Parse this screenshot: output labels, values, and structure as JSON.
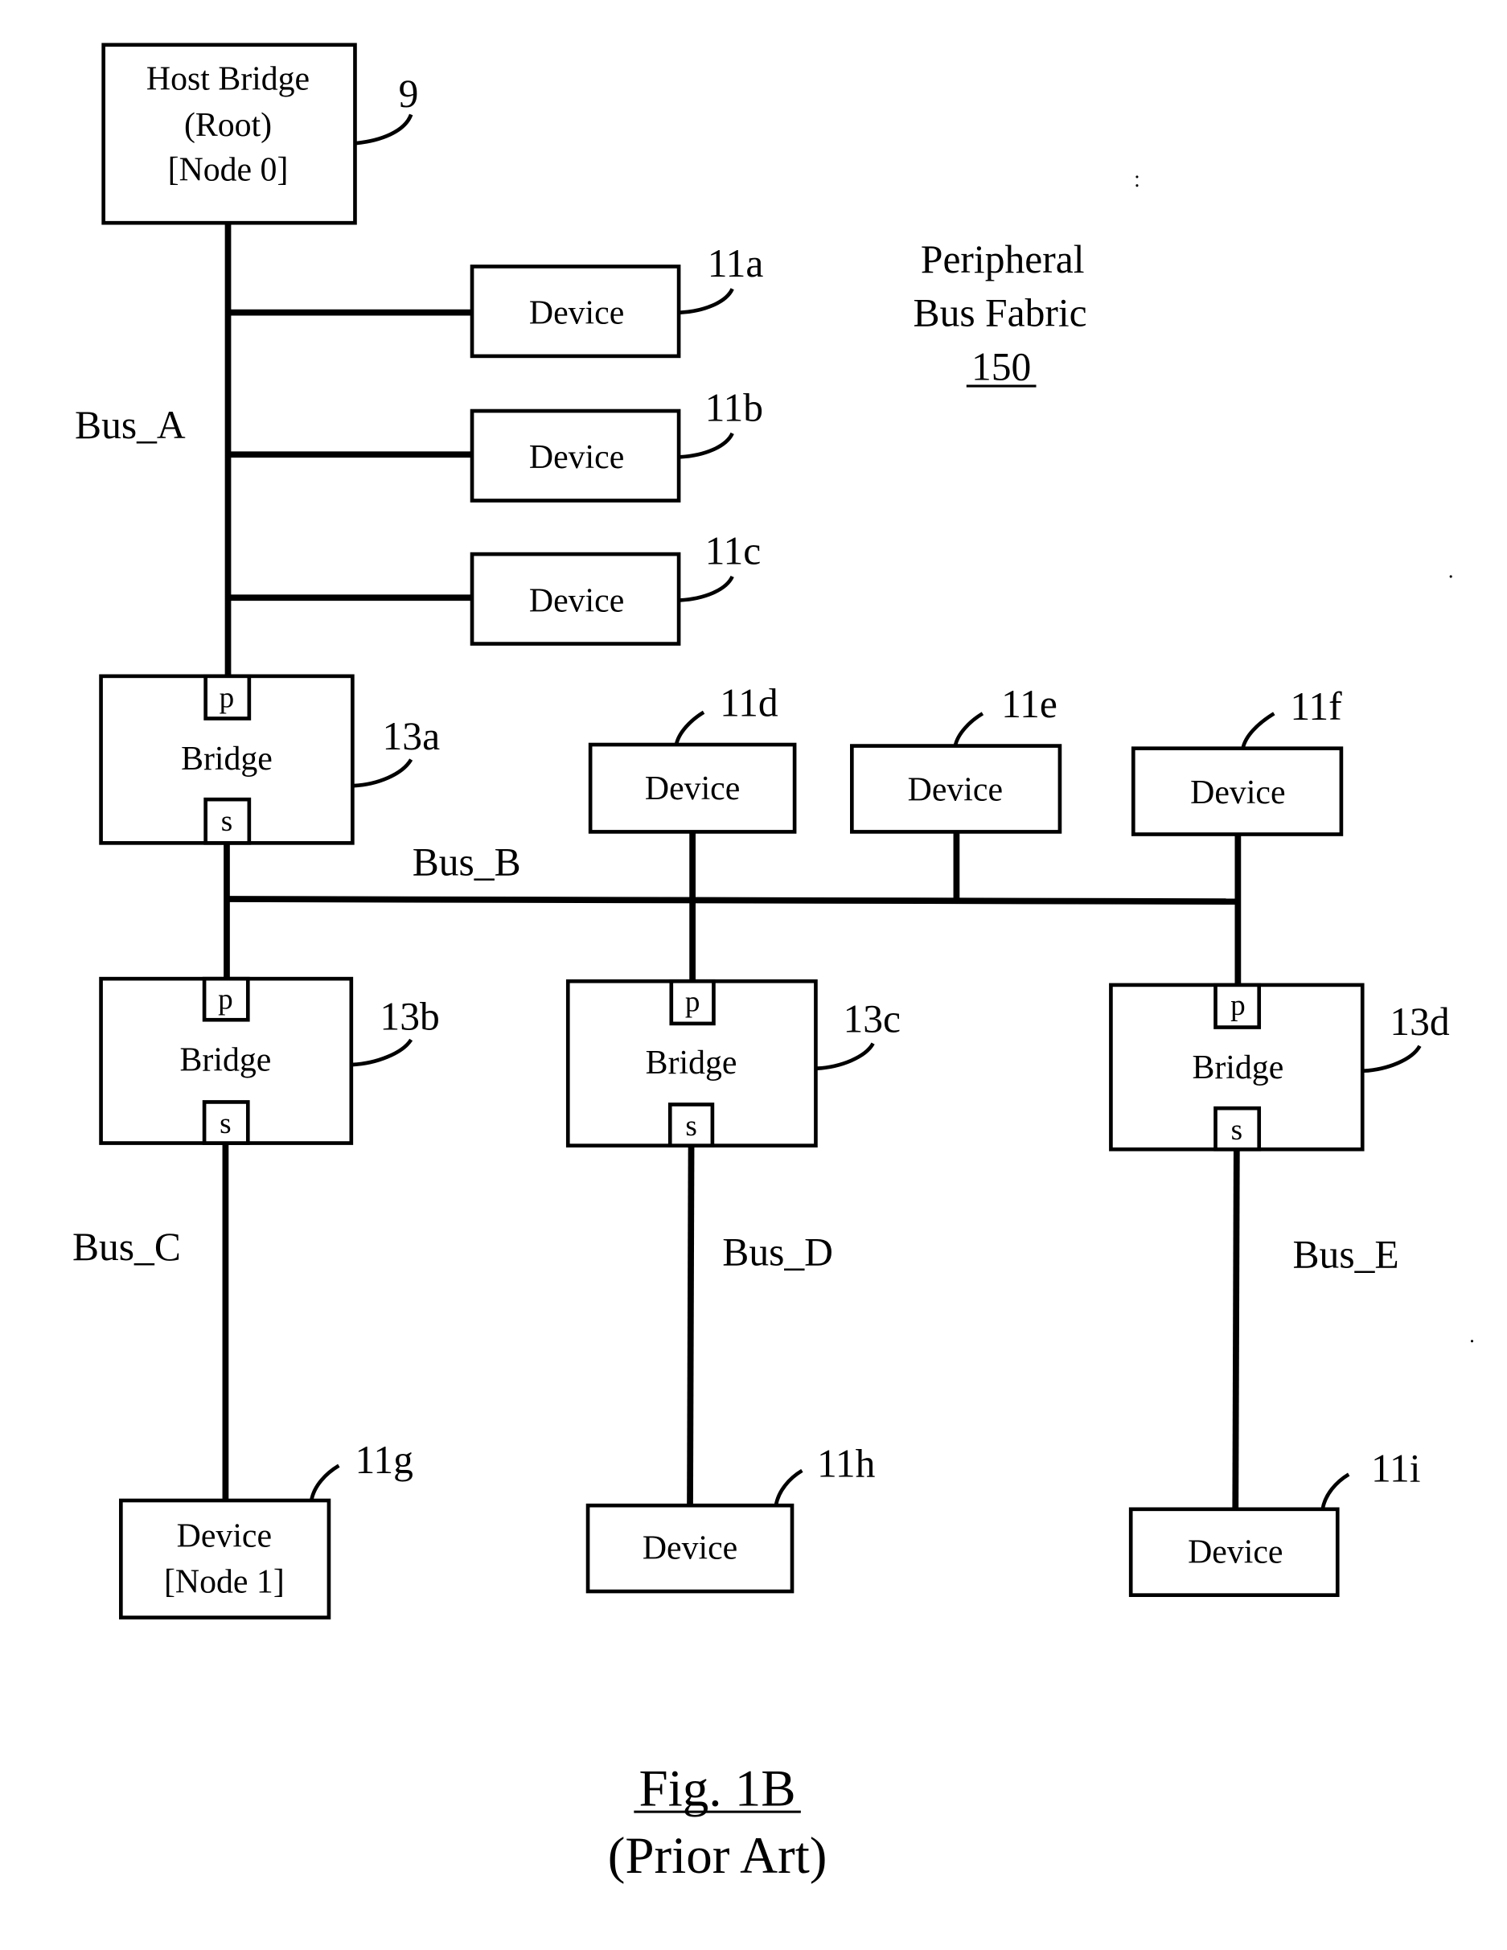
{
  "figure": {
    "caption": "Fig. 1B",
    "subcaption": "(Prior Art)"
  },
  "fabric": {
    "line1": "Peripheral",
    "line2": "Bus Fabric",
    "ref": "150"
  },
  "host_bridge": {
    "line1": "Host Bridge",
    "line2": "(Root)",
    "line3": "[Node 0]",
    "ref": "9"
  },
  "buses": {
    "a": "Bus_A",
    "b": "Bus_B",
    "c": "Bus_C",
    "d": "Bus_D",
    "e": "Bus_E"
  },
  "bridges": [
    {
      "label": "Bridge",
      "ref": "13a",
      "primary_port": "p",
      "secondary_port": "s"
    },
    {
      "label": "Bridge",
      "ref": "13b",
      "primary_port": "p",
      "secondary_port": "s"
    },
    {
      "label": "Bridge",
      "ref": "13c",
      "primary_port": "p",
      "secondary_port": "s"
    },
    {
      "label": "Bridge",
      "ref": "13d",
      "primary_port": "p",
      "secondary_port": "s"
    }
  ],
  "devices": [
    {
      "label": "Device",
      "ref": "11a"
    },
    {
      "label": "Device",
      "ref": "11b"
    },
    {
      "label": "Device",
      "ref": "11c"
    },
    {
      "label": "Device",
      "ref": "11d"
    },
    {
      "label": "Device",
      "ref": "11e"
    },
    {
      "label": "Device",
      "ref": "11f"
    },
    {
      "label": "Device",
      "sublabel": "[Node 1]",
      "ref": "11g"
    },
    {
      "label": "Device",
      "ref": "11h"
    },
    {
      "label": "Device",
      "ref": "11i"
    }
  ]
}
